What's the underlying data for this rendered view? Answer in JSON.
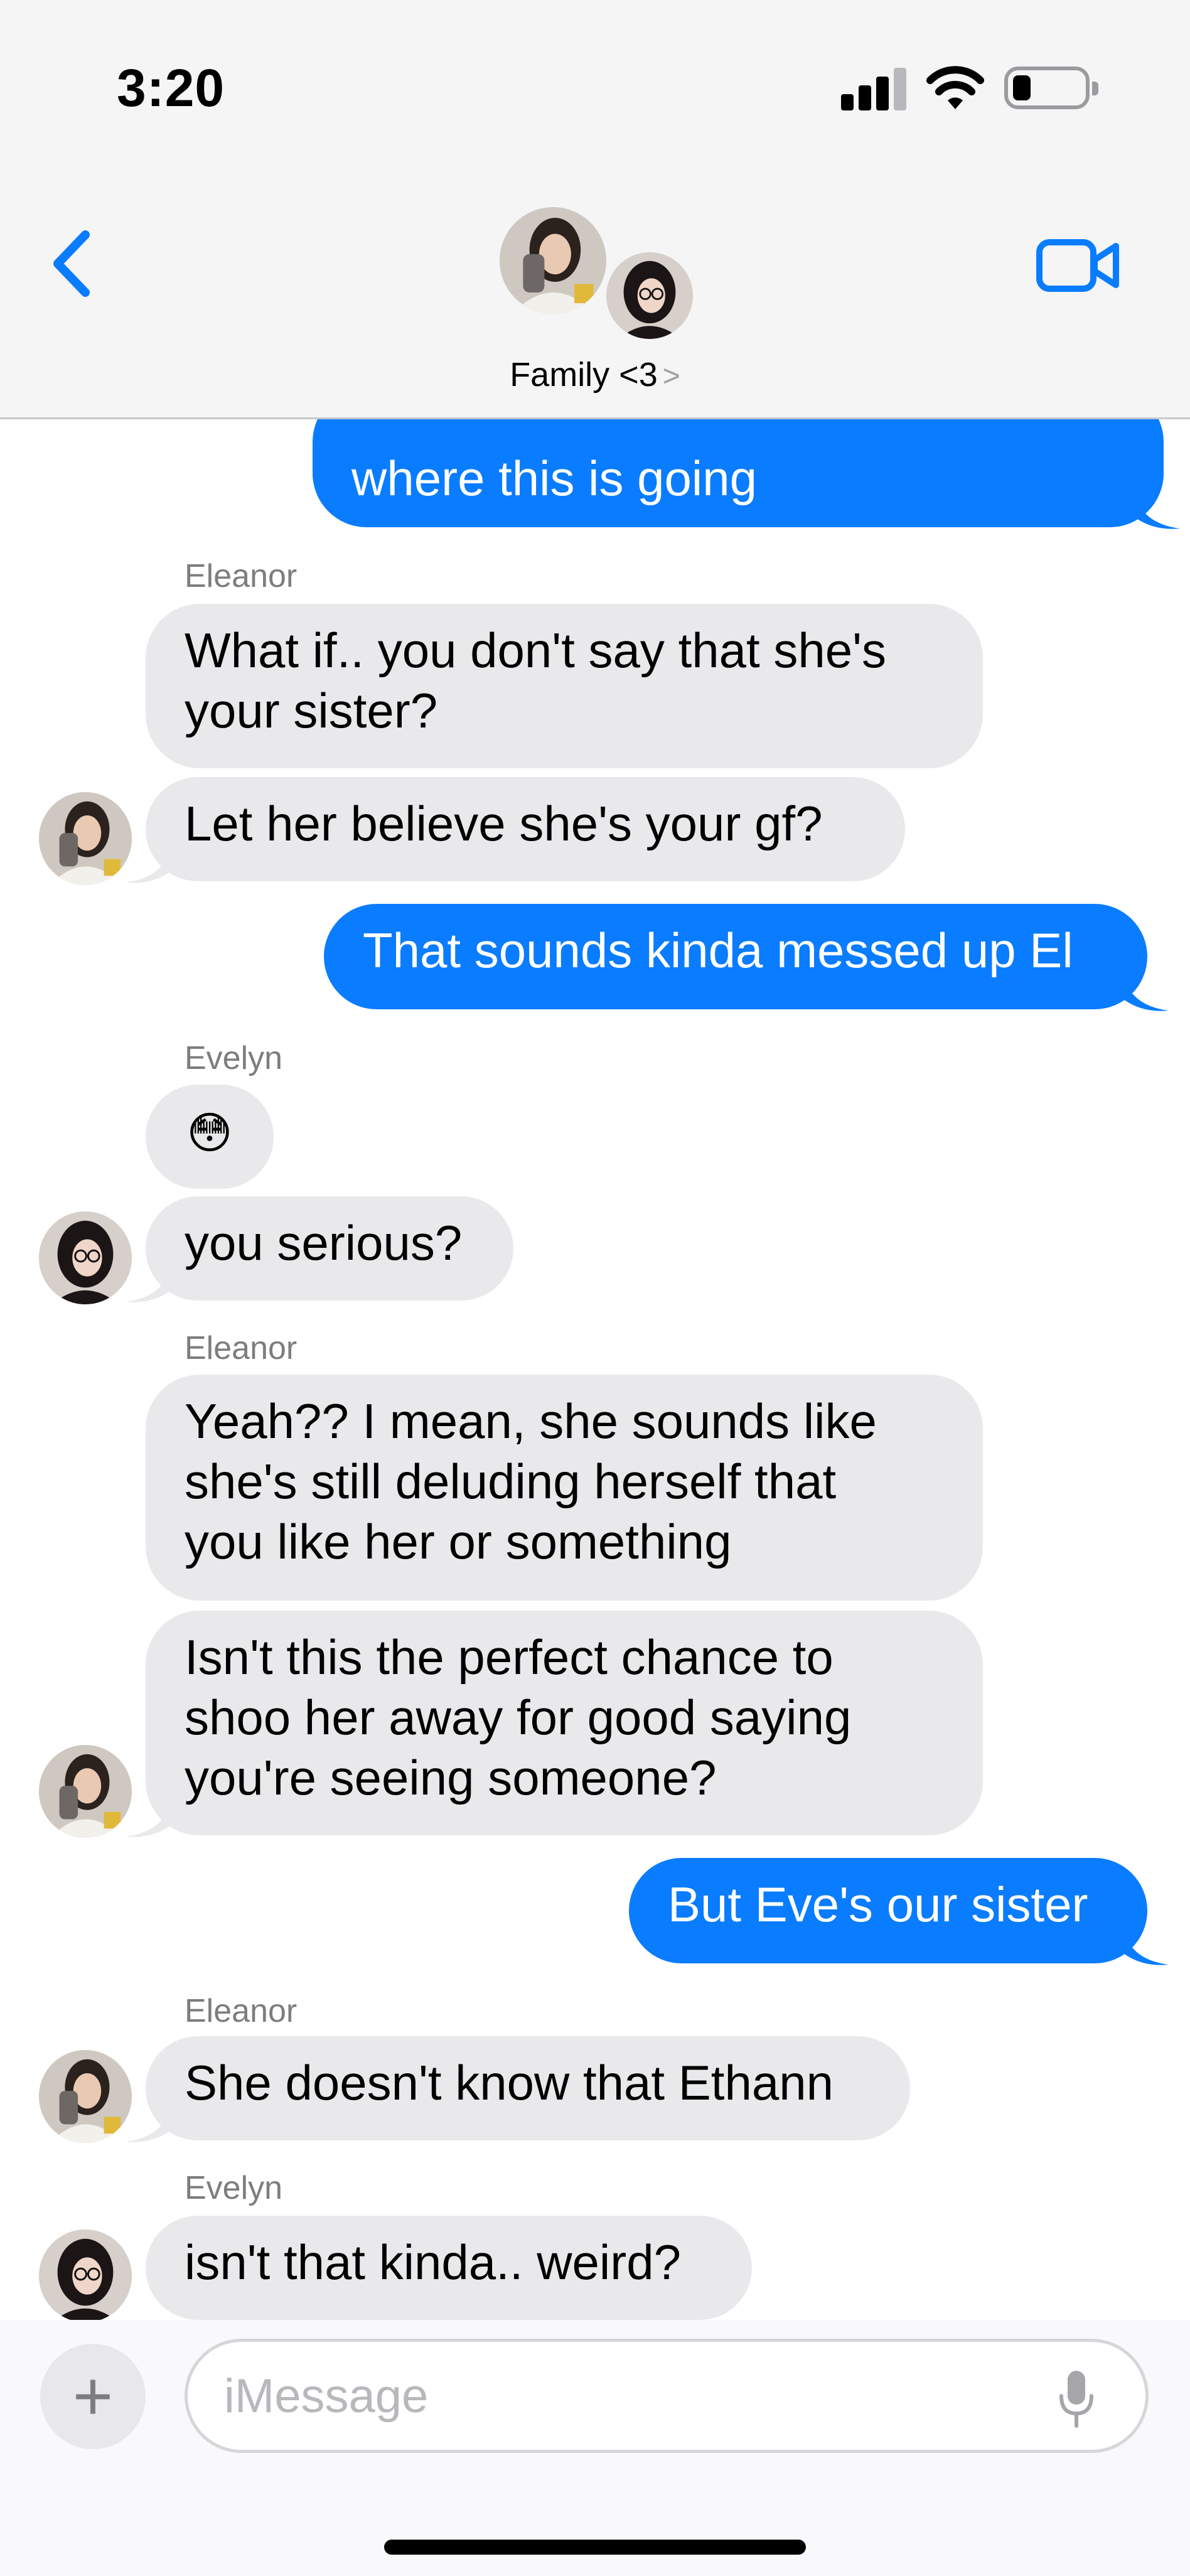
{
  "status_bar": {
    "time": "3:20"
  },
  "header": {
    "group_name": "Family <3",
    "chevron": ">"
  },
  "messages": {
    "m0": {
      "text": "where this is going"
    },
    "m1": {
      "sender": "Eleanor",
      "line1": "What if.. you don't say that she's",
      "line2": "your sister?"
    },
    "m2": {
      "text": "Let her believe she's your gf?"
    },
    "m3": {
      "text": "That sounds kinda messed up El"
    },
    "m4": {
      "sender": "Evelyn",
      "emoji": "😳"
    },
    "m5": {
      "text": "you serious?"
    },
    "m6": {
      "sender": "Eleanor",
      "line1": "Yeah?? I mean, she sounds like",
      "line2": "she's still deluding herself that",
      "line3": "you like her or something"
    },
    "m7": {
      "line1": "Isn't this the perfect chance to",
      "line2": "shoo her away for good saying",
      "line3": "you're seeing someone?"
    },
    "m8": {
      "text": "But Eve's our sister"
    },
    "m9": {
      "sender": "Eleanor",
      "text": "She doesn't know that Ethann"
    },
    "m10": {
      "sender": "Evelyn",
      "text": "isn't that kinda.. weird?"
    }
  },
  "composer": {
    "placeholder": "iMessage",
    "plus": "+"
  },
  "colors": {
    "outgoing_bubble": "#0a7cff",
    "incoming_bubble": "#e9e9eb",
    "accent": "#0a7cff"
  },
  "icons": [
    "back-chevron-icon",
    "video-camera-icon",
    "signal-icon",
    "wifi-icon",
    "battery-icon",
    "plus-icon",
    "microphone-icon"
  ]
}
